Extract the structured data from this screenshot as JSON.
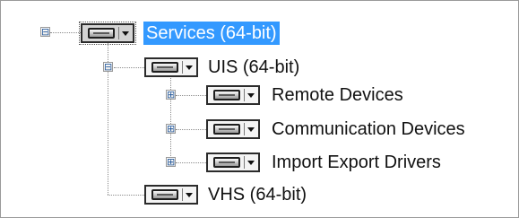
{
  "tree": {
    "root": {
      "label": "Services (64-bit)",
      "expander": "⊟",
      "selected": true
    },
    "uis": {
      "label": "UIS (64-bit)",
      "expander": "⊟"
    },
    "remote": {
      "label": "Remote Devices",
      "expander": "⊞"
    },
    "communication": {
      "label": "Communication Devices",
      "expander": "⊞"
    },
    "import_export": {
      "label": "Import Export Drivers",
      "expander": "⊞"
    },
    "vhs": {
      "label": "VHS (64-bit)"
    }
  },
  "icons": {
    "node_icon": "drive-icon",
    "dropdown": "caret-down-icon",
    "expand": "plus-icon",
    "collapse": "minus-icon"
  },
  "colors": {
    "selection_bg": "#3399ff",
    "selection_text": "#ffffff",
    "text": "#111111",
    "connector": "#8c8c8c"
  }
}
